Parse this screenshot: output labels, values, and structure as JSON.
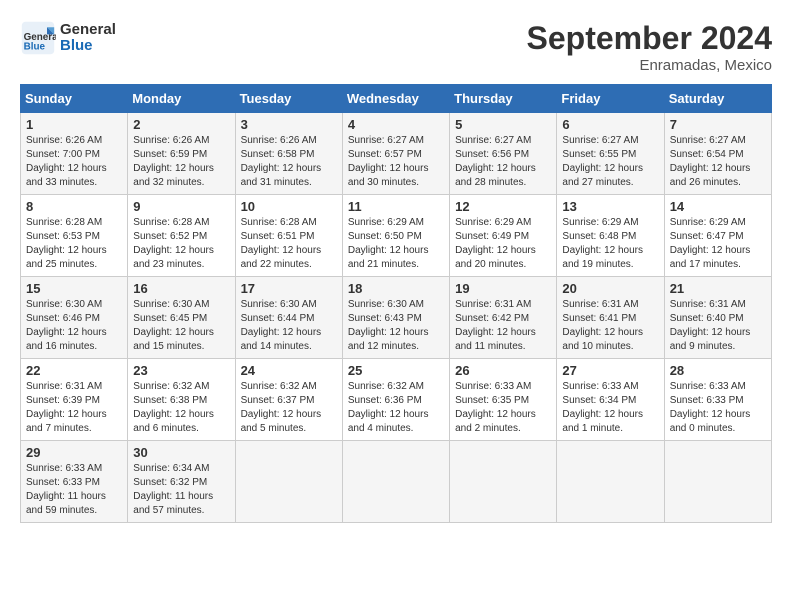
{
  "logo": {
    "line1": "General",
    "line2": "Blue"
  },
  "title": "September 2024",
  "location": "Enramadas, Mexico",
  "days_of_week": [
    "Sunday",
    "Monday",
    "Tuesday",
    "Wednesday",
    "Thursday",
    "Friday",
    "Saturday"
  ],
  "weeks": [
    [
      {
        "day": "1",
        "info": "Sunrise: 6:26 AM\nSunset: 7:00 PM\nDaylight: 12 hours\nand 33 minutes."
      },
      {
        "day": "2",
        "info": "Sunrise: 6:26 AM\nSunset: 6:59 PM\nDaylight: 12 hours\nand 32 minutes."
      },
      {
        "day": "3",
        "info": "Sunrise: 6:26 AM\nSunset: 6:58 PM\nDaylight: 12 hours\nand 31 minutes."
      },
      {
        "day": "4",
        "info": "Sunrise: 6:27 AM\nSunset: 6:57 PM\nDaylight: 12 hours\nand 30 minutes."
      },
      {
        "day": "5",
        "info": "Sunrise: 6:27 AM\nSunset: 6:56 PM\nDaylight: 12 hours\nand 28 minutes."
      },
      {
        "day": "6",
        "info": "Sunrise: 6:27 AM\nSunset: 6:55 PM\nDaylight: 12 hours\nand 27 minutes."
      },
      {
        "day": "7",
        "info": "Sunrise: 6:27 AM\nSunset: 6:54 PM\nDaylight: 12 hours\nand 26 minutes."
      }
    ],
    [
      {
        "day": "8",
        "info": "Sunrise: 6:28 AM\nSunset: 6:53 PM\nDaylight: 12 hours\nand 25 minutes."
      },
      {
        "day": "9",
        "info": "Sunrise: 6:28 AM\nSunset: 6:52 PM\nDaylight: 12 hours\nand 23 minutes."
      },
      {
        "day": "10",
        "info": "Sunrise: 6:28 AM\nSunset: 6:51 PM\nDaylight: 12 hours\nand 22 minutes."
      },
      {
        "day": "11",
        "info": "Sunrise: 6:29 AM\nSunset: 6:50 PM\nDaylight: 12 hours\nand 21 minutes."
      },
      {
        "day": "12",
        "info": "Sunrise: 6:29 AM\nSunset: 6:49 PM\nDaylight: 12 hours\nand 20 minutes."
      },
      {
        "day": "13",
        "info": "Sunrise: 6:29 AM\nSunset: 6:48 PM\nDaylight: 12 hours\nand 19 minutes."
      },
      {
        "day": "14",
        "info": "Sunrise: 6:29 AM\nSunset: 6:47 PM\nDaylight: 12 hours\nand 17 minutes."
      }
    ],
    [
      {
        "day": "15",
        "info": "Sunrise: 6:30 AM\nSunset: 6:46 PM\nDaylight: 12 hours\nand 16 minutes."
      },
      {
        "day": "16",
        "info": "Sunrise: 6:30 AM\nSunset: 6:45 PM\nDaylight: 12 hours\nand 15 minutes."
      },
      {
        "day": "17",
        "info": "Sunrise: 6:30 AM\nSunset: 6:44 PM\nDaylight: 12 hours\nand 14 minutes."
      },
      {
        "day": "18",
        "info": "Sunrise: 6:30 AM\nSunset: 6:43 PM\nDaylight: 12 hours\nand 12 minutes."
      },
      {
        "day": "19",
        "info": "Sunrise: 6:31 AM\nSunset: 6:42 PM\nDaylight: 12 hours\nand 11 minutes."
      },
      {
        "day": "20",
        "info": "Sunrise: 6:31 AM\nSunset: 6:41 PM\nDaylight: 12 hours\nand 10 minutes."
      },
      {
        "day": "21",
        "info": "Sunrise: 6:31 AM\nSunset: 6:40 PM\nDaylight: 12 hours\nand 9 minutes."
      }
    ],
    [
      {
        "day": "22",
        "info": "Sunrise: 6:31 AM\nSunset: 6:39 PM\nDaylight: 12 hours\nand 7 minutes."
      },
      {
        "day": "23",
        "info": "Sunrise: 6:32 AM\nSunset: 6:38 PM\nDaylight: 12 hours\nand 6 minutes."
      },
      {
        "day": "24",
        "info": "Sunrise: 6:32 AM\nSunset: 6:37 PM\nDaylight: 12 hours\nand 5 minutes."
      },
      {
        "day": "25",
        "info": "Sunrise: 6:32 AM\nSunset: 6:36 PM\nDaylight: 12 hours\nand 4 minutes."
      },
      {
        "day": "26",
        "info": "Sunrise: 6:33 AM\nSunset: 6:35 PM\nDaylight: 12 hours\nand 2 minutes."
      },
      {
        "day": "27",
        "info": "Sunrise: 6:33 AM\nSunset: 6:34 PM\nDaylight: 12 hours\nand 1 minute."
      },
      {
        "day": "28",
        "info": "Sunrise: 6:33 AM\nSunset: 6:33 PM\nDaylight: 12 hours\nand 0 minutes."
      }
    ],
    [
      {
        "day": "29",
        "info": "Sunrise: 6:33 AM\nSunset: 6:33 PM\nDaylight: 11 hours\nand 59 minutes."
      },
      {
        "day": "30",
        "info": "Sunrise: 6:34 AM\nSunset: 6:32 PM\nDaylight: 11 hours\nand 57 minutes."
      },
      {
        "day": "",
        "info": ""
      },
      {
        "day": "",
        "info": ""
      },
      {
        "day": "",
        "info": ""
      },
      {
        "day": "",
        "info": ""
      },
      {
        "day": "",
        "info": ""
      }
    ]
  ]
}
